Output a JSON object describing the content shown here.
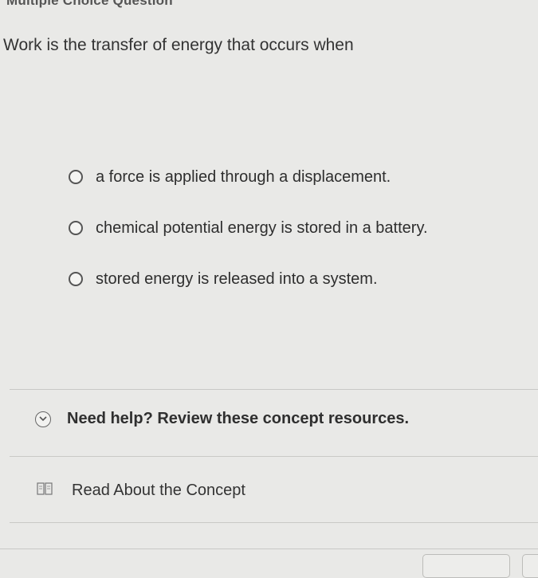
{
  "header": {
    "title": "Multiple Choice Question"
  },
  "question": {
    "text": "Work is the transfer of energy that occurs when"
  },
  "options": [
    {
      "label": "a force is applied through a displacement."
    },
    {
      "label": "chemical potential energy is stored in a battery."
    },
    {
      "label": "stored energy is released into a system."
    }
  ],
  "help": {
    "label": "Need help? Review these concept resources.",
    "icon": "chevron-down-icon"
  },
  "resources": [
    {
      "label": "Read About the Concept",
      "icon": "book-icon"
    }
  ],
  "colors": {
    "background": "#e9e9e7",
    "text": "#2b2b2b",
    "divider": "#c9c9c6"
  }
}
